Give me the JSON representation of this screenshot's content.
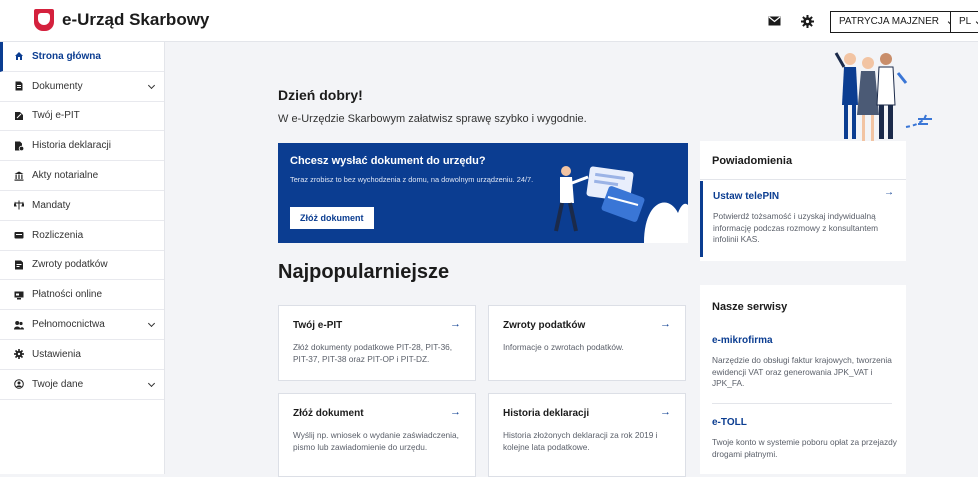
{
  "header": {
    "brand": "e-Urząd Skarbowy",
    "user_label": "PATRYCJA MAJZNER",
    "lang_label": "PL",
    "icons": [
      "mail-icon",
      "gear-icon",
      "chevron-down-icon"
    ]
  },
  "sidebar": {
    "items": [
      {
        "label": "Strona główna",
        "icon": "home-icon"
      },
      {
        "label": "Dokumenty",
        "icon": "document-icon"
      },
      {
        "label": "Twój e-PIT",
        "icon": "pit-icon"
      },
      {
        "label": "Historia deklaracji",
        "icon": "history-icon"
      },
      {
        "label": "Akty notarialne",
        "icon": "notary-icon"
      },
      {
        "label": "Mandaty",
        "icon": "fine-icon"
      },
      {
        "label": "Rozliczenia",
        "icon": "settlement-icon"
      },
      {
        "label": "Zwroty podatków",
        "icon": "refund-icon"
      },
      {
        "label": "Płatności online",
        "icon": "payment-icon"
      },
      {
        "label": "Pełnomocnictwa",
        "icon": "proxy-icon"
      },
      {
        "label": "Ustawienia",
        "icon": "gear-icon"
      },
      {
        "label": "Twoje dane",
        "icon": "user-icon"
      }
    ]
  },
  "main": {
    "greeting": "Dzień dobry!",
    "subtitle": "W e-Urzędzie Skarbowym załatwisz sprawę szybko i wygodnie.",
    "banner": {
      "title": "Chcesz wysłać dokument do urzędu?",
      "text": "Teraz zrobisz to bez wychodzenia z domu, na dowolnym urządzeniu. 24/7.",
      "button": "Złóż dokument"
    },
    "popular_title": "Najpopularniejsze",
    "cards": [
      {
        "title": "Twój e-PIT",
        "text": "Złóż dokumenty podatkowe PIT-28, PIT-36, PIT-37, PIT-38 oraz PIT-OP i PIT-DZ."
      },
      {
        "title": "Zwroty podatków",
        "text": "Informacje o zwrotach podatków."
      },
      {
        "title": "Złóż dokument",
        "text": "Wyślij np. wniosek o wydanie zaświadczenia, pismo lub zawiadomienie do urzędu."
      },
      {
        "title": "Historia deklaracji",
        "text": "Historia złożonych deklaracji za rok 2019 i kolejne lata podatkowe."
      }
    ]
  },
  "notifications": {
    "title": "Powiadomienia",
    "item_title": "Ustaw telePIN",
    "item_text": "Potwierdź tożsamość i uzyskaj indywidualną informację podczas rozmowy z konsultantem infolinii KAS."
  },
  "services": {
    "title": "Nasze serwisy",
    "items": [
      {
        "title": "e-mikrofirma",
        "text": "Narzędzie do obsługi faktur krajowych, tworzenia ewidencji VAT oraz generowania JPK_VAT i JPK_FA."
      },
      {
        "title": "e-TOLL",
        "text": "Twoje konto w systemie poboru opłat za przejazdy drogami płatnymi."
      }
    ]
  },
  "colors": {
    "primary": "#0b3d91",
    "brand_red": "#d4213d",
    "background": "#f3f4f7"
  }
}
